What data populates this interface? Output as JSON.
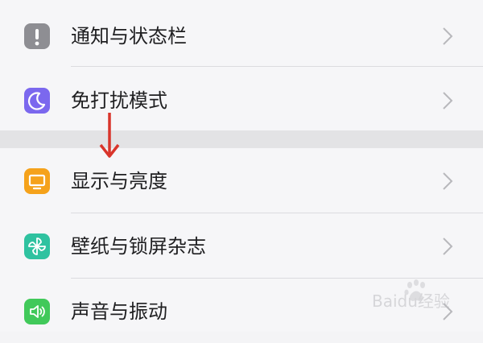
{
  "colors": {
    "notification_icon_bg": "#8e8e93",
    "dnd_icon_bg": "#7b68ee",
    "display_icon_bg": "#f5a21b",
    "wallpaper_icon_bg": "#2fc2a0",
    "sound_icon_bg": "#41c95a",
    "annotation_arrow": "#d9352b"
  },
  "settings": {
    "items": [
      {
        "label": "通知与状态栏",
        "icon": "exclamation-icon"
      },
      {
        "label": "免打扰模式",
        "icon": "moon-icon"
      },
      {
        "label": "显示与亮度",
        "icon": "monitor-icon"
      },
      {
        "label": "壁纸与锁屏杂志",
        "icon": "pinwheel-icon"
      },
      {
        "label": "声音与振动",
        "icon": "speaker-icon"
      }
    ]
  },
  "watermark": {
    "text": "Baidu经验"
  }
}
